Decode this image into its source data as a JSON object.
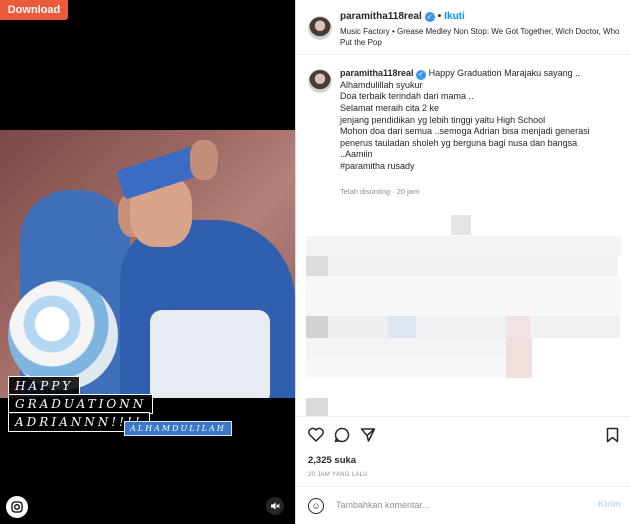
{
  "download": {
    "label": "Download",
    "color": "#ec5a3c"
  },
  "media": {
    "caption_lines": [
      "HAPPY",
      "GRADUATIONN",
      "ADRIANNN!!!!"
    ],
    "tag": "ALHAMDULILAH",
    "left_icon": "instagram-icon",
    "mute_icon": "speaker-mute-icon"
  },
  "header": {
    "username": "paramitha118real",
    "separator": "•",
    "follow_label": "Ikuti",
    "music": "Music Factory • Grease Medley Non Stop: We Got Together, Wich Doctor, Who Put the Pop"
  },
  "post": {
    "username": "paramitha118real",
    "lines": [
      "Happy Graduation Marajaku sayang ..",
      "Alhamdulillah syukur",
      "Doa terbaik terindah dari mama ..",
      "Selamat meraih cita 2 ke",
      "jenjang pendidikan yg lebih tinggi yaitu High School",
      "Mohon doa dari semua ..semoga Adrian bisa menjadi generasi",
      "penerus tauladan sholeh yg berguna bagi nusa dan bangsa",
      "..Aamiin",
      "#paramitha rusady"
    ],
    "edited": "Telah disunting · 20 jam"
  },
  "stats": {
    "likes": "2,325 suka",
    "time": "20 JAM YANG LALU"
  },
  "comment_box": {
    "placeholder": "Tambahkan komentar...",
    "post_label": "Kirim"
  },
  "colors": {
    "accent": "#0095f6",
    "verified": "#3897f0"
  }
}
